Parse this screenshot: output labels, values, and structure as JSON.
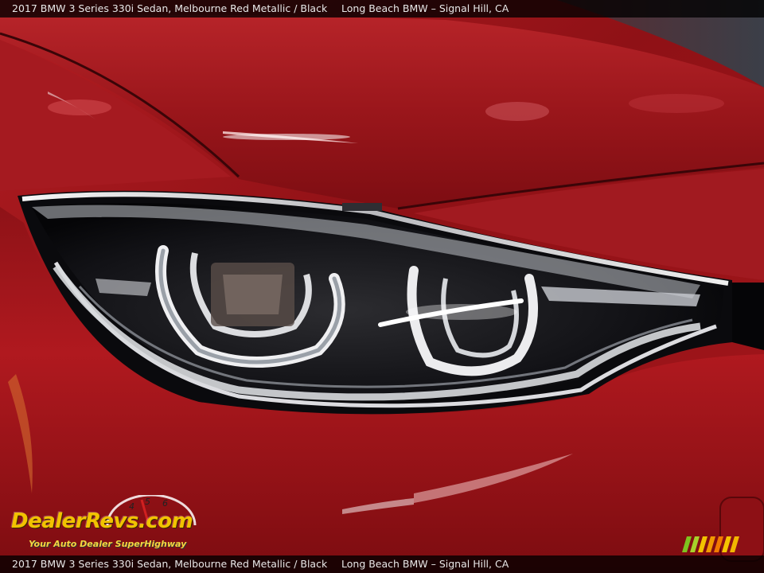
{
  "caption": {
    "vehicle": "2017 BMW 3 Series 330i Sedan,  Melbourne Red Metallic / Black",
    "dealer": "Long Beach BMW – Signal Hill, CA"
  },
  "watermark": {
    "brand": "DealerRevs.com",
    "tagline": "Your Auto Dealer SuperHighway",
    "gauge_digits": [
      "4",
      "5",
      "6"
    ]
  },
  "colors": {
    "paint": "#a8171c",
    "paint_highlight": "#e0575a",
    "caption_bar": "#000000",
    "watermark_yellow": "#f2c200"
  },
  "icons": [
    "speedometer-logo-icon",
    "color-stripes-icon"
  ]
}
